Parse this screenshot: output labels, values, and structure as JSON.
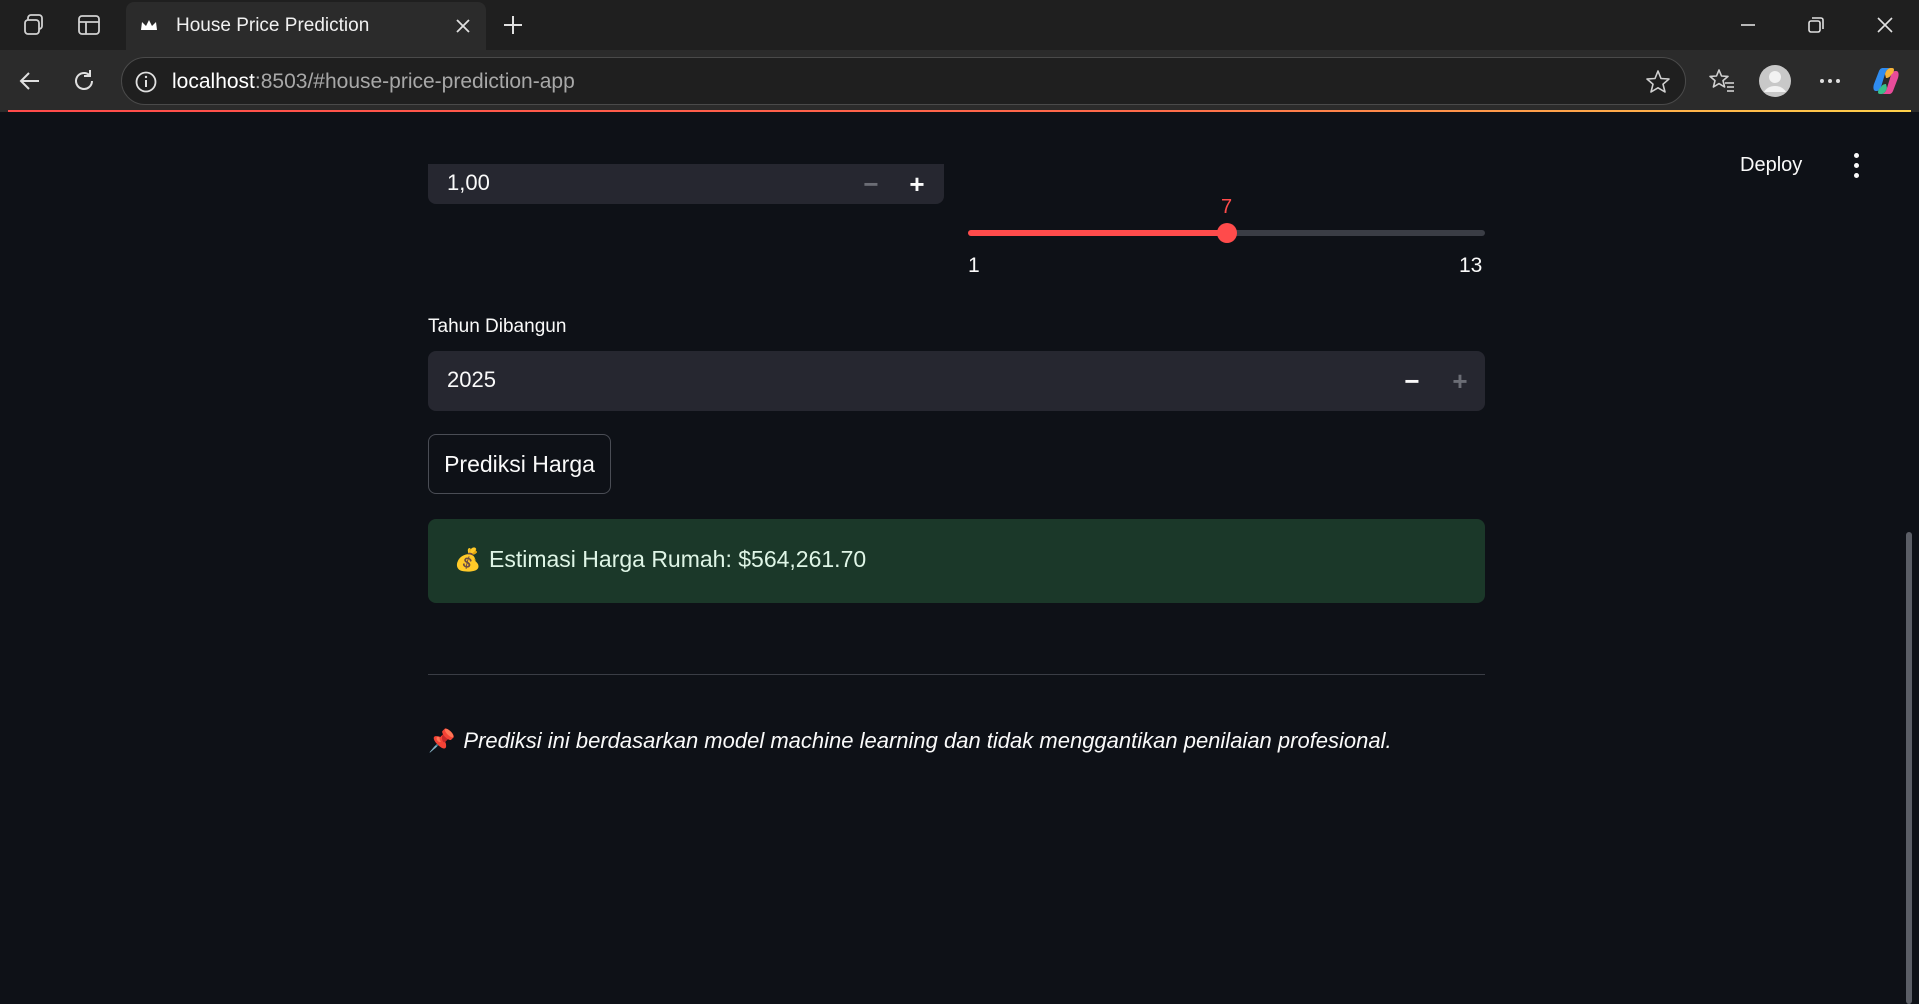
{
  "browser": {
    "tab_title": "House Price Prediction",
    "url_host": "localhost",
    "url_rest": ":8503/#house-price-prediction-app"
  },
  "app": {
    "deploy_label": "Deploy",
    "top_number_input": {
      "value": "1,00",
      "minus": "−",
      "plus": "+"
    },
    "slider": {
      "value": "7",
      "min": "1",
      "max": "13",
      "fill_fraction": 0.5
    },
    "year_input": {
      "label": "Tahun Dibangun",
      "value": "2025",
      "minus": "−",
      "plus": "+"
    },
    "predict_button": "Prediksi Harga",
    "result": {
      "icon": "💰",
      "text": "Estimasi Harga Rumah: $564,261.70"
    },
    "disclaimer": {
      "icon": "📌",
      "text": "Prediksi ini berdasarkan model machine learning dan tidak menggantikan penilaian profesional."
    }
  },
  "colors": {
    "accent": "#ff4b4b",
    "success_bg": "#1b3829",
    "app_bg": "#0e1117"
  }
}
